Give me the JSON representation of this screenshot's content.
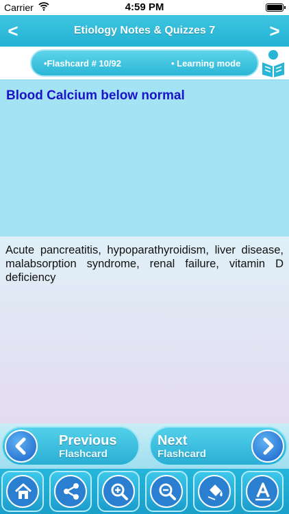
{
  "status_bar": {
    "carrier": "Carrier",
    "time": "4:59 PM"
  },
  "nav": {
    "title": "Etiology Notes & Quizzes 7",
    "back_symbol": "<",
    "forward_symbol": ">"
  },
  "info": {
    "flashcard_label": "•Flashcard #  10/92",
    "mode_label": "• Learning mode",
    "mode_icon": "reading-person-icon"
  },
  "card": {
    "question": "Blood Calcium below normal",
    "answer": "Acute pancreatitis, hypoparathyroidism, liver disease, malabsorption syndrome, renal failure, vitamin D deficiency"
  },
  "nav_buttons": {
    "previous": {
      "line1": "Previous",
      "line2": "Flashcard"
    },
    "next": {
      "line1": "Next",
      "line2": "Flashcard"
    }
  },
  "toolbar": [
    {
      "name": "home",
      "icon": "home-icon"
    },
    {
      "name": "share",
      "icon": "share-icon"
    },
    {
      "name": "zoom-in",
      "icon": "zoom-in-icon"
    },
    {
      "name": "zoom-out",
      "icon": "zoom-out-icon"
    },
    {
      "name": "color",
      "icon": "paint-bucket-icon"
    },
    {
      "name": "font",
      "icon": "font-icon"
    }
  ],
  "colors": {
    "accent": "#29b6d6",
    "question_text": "#1a14c8",
    "question_bg": "#a4e3f3",
    "button_blue": "#1661c9"
  }
}
